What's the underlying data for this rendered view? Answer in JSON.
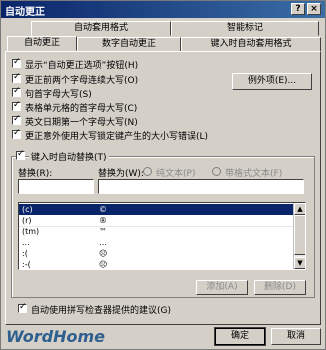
{
  "window": {
    "title": "自动更正",
    "help_icon": "?",
    "close_icon": "×"
  },
  "tabs": {
    "row1": [
      "自动套用格式",
      "智能标记"
    ],
    "row2": [
      "自动更正",
      "数字自动更正",
      "键入时自动套用格式"
    ],
    "active": "自动更正"
  },
  "options": [
    {
      "label": "显示“自动更正选项”按钮(H)",
      "checked": true
    },
    {
      "label": "更正前两个字母连续大写(O)",
      "checked": true
    },
    {
      "label": "句首字母大写(S)",
      "checked": true
    },
    {
      "label": "表格单元格的首字母大写(C)",
      "checked": true
    },
    {
      "label": "英文日期第一个字母大写(N)",
      "checked": true
    },
    {
      "label": "更正意外使用大写锁定键产生的大小写错误(L)",
      "checked": true
    }
  ],
  "exceptions_button": "例外项(E)...",
  "replace_while_typing": {
    "label": "键入时自动替换(T)",
    "checked": true
  },
  "replace_label": "替换(R):",
  "with_label": "替换为(W):",
  "plain_text": "纯文本(P)",
  "formatted_text": "带格式文本(F)",
  "replace_value": "",
  "with_value": "",
  "entries": [
    {
      "from": "(c)",
      "to": "©"
    },
    {
      "from": "(r)",
      "to": "®"
    },
    {
      "from": "(tm)",
      "to": "™"
    },
    {
      "from": "...",
      "to": "…"
    },
    {
      "from": ":(",
      "to": "☹"
    },
    {
      "from": ":-(",
      "to": "☹"
    }
  ],
  "add_button": "添加(A)",
  "delete_button": "删除(D)",
  "spell_suggest": {
    "label": "自动使用拼写检查器提供的建议(G)",
    "checked": true
  },
  "ok_button": "确定",
  "cancel_button": "取消",
  "watermark": "WordHome"
}
